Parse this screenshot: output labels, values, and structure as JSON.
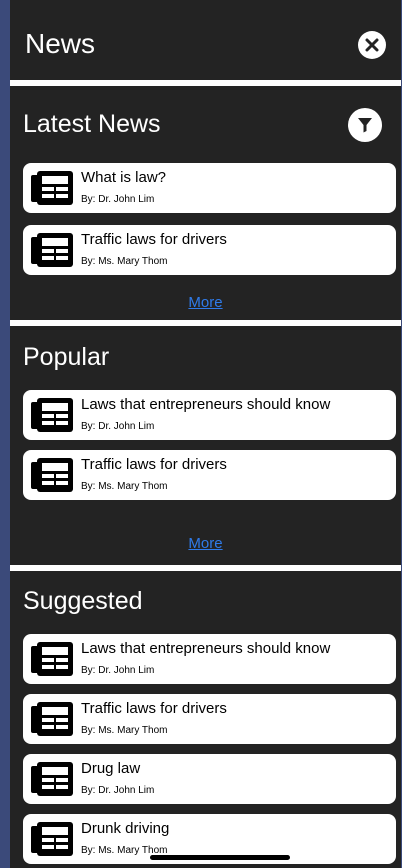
{
  "header": {
    "title": "News",
    "close_icon": "close-circle-icon"
  },
  "sections": {
    "latest": {
      "title": "Latest News",
      "filter_icon": "filter-icon",
      "items": [
        {
          "headline": "What is law?",
          "author": "By: Dr. John Lim"
        },
        {
          "headline": "Traffic laws for drivers",
          "author": "By: Ms. Mary Thom"
        }
      ],
      "more_label": "More"
    },
    "popular": {
      "title": "Popular",
      "items": [
        {
          "headline": "Laws that entrepreneurs should know",
          "author": "By: Dr. John Lim"
        },
        {
          "headline": "Traffic laws for drivers",
          "author": "By: Ms. Mary Thom"
        }
      ],
      "more_label": "More"
    },
    "suggested": {
      "title": "Suggested",
      "items": [
        {
          "headline": "Laws that entrepreneurs should know",
          "author": "By: Dr. John Lim"
        },
        {
          "headline": "Traffic laws for drivers",
          "author": "By: Ms. Mary Thom"
        },
        {
          "headline": "Drug law",
          "author": "By: Dr. John Lim"
        },
        {
          "headline": "Drunk driving",
          "author": "By: Ms. Mary Thom"
        }
      ]
    }
  },
  "colors": {
    "panel_bg": "#232323",
    "page_bg": "#3b4a7a",
    "link": "#2f7bea",
    "card_bg": "#ffffff"
  }
}
